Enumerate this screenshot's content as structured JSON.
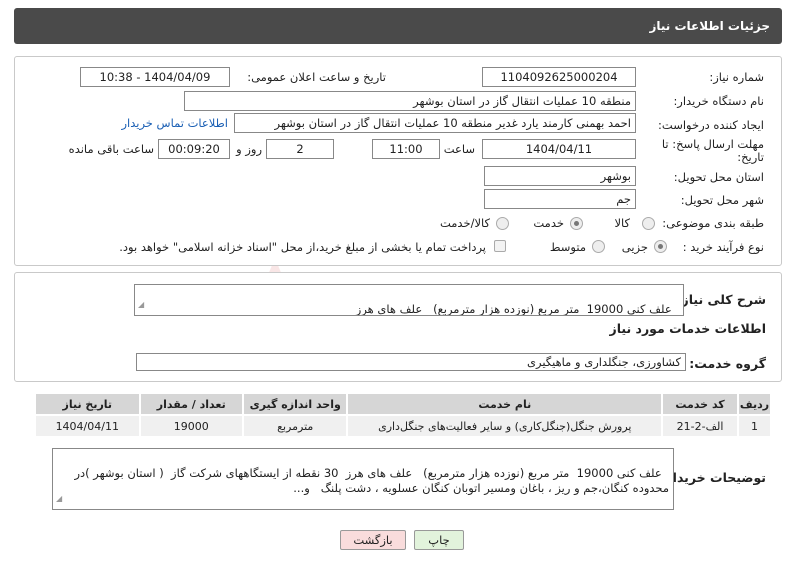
{
  "header": {
    "title": "جزئیات اطلاعات نیاز"
  },
  "form": {
    "need_number_label": "شماره نیاز:",
    "need_number": "1104092625000204",
    "announce_label": "تاریخ و ساعت اعلان عمومی:",
    "announce_value": "1404/04/09 - 10:38",
    "buyer_org_label": "نام دستگاه خریدار:",
    "buyer_org": "منطقه 10 عملیات انتقال گاز در استان بوشهر",
    "creator_label": "ایجاد کننده درخواست:",
    "creator": "احمد بهمنی کارمند یارد غدیر منطقه 10 عملیات انتقال گاز در استان بوشهر",
    "contact_link": "اطلاعات تماس خریدار",
    "deadline_label": "مهلت ارسال پاسخ: تا تاریخ:",
    "deadline_date": "1404/04/11",
    "time_label": "ساعت",
    "deadline_time": "11:00",
    "days_value": "2",
    "days_label": "روز و",
    "remaining_time": "00:09:20",
    "remaining_label": "ساعت باقی مانده",
    "province_label": "استان محل تحویل:",
    "province": "بوشهر",
    "city_label": "شهر محل تحویل:",
    "city": "جم",
    "category_label": "طبقه بندی موضوعی:",
    "category_options": [
      "کالا",
      "خدمت",
      "کالا/خدمت"
    ],
    "category_selected": "خدمت",
    "process_label": "نوع فرآیند خرید :",
    "process_options": [
      "جزیی",
      "متوسط"
    ],
    "process_selected": "جزیی",
    "payment_note": "پرداخت تمام یا بخشی از مبلغ خرید،از محل \"اسناد خزانه اسلامی\" خواهد بود."
  },
  "summary": {
    "label": "شرح کلی نیاز:",
    "text": "علف کنی 19000  متر مربع (نوزده هزار مترمربع)   علف های هرز"
  },
  "services": {
    "section_title": "اطلاعات خدمات مورد نیاز",
    "group_label": "گروه خدمت:",
    "group_value": "کشاورزی، جنگلداری و ماهیگیری",
    "columns": [
      "ردیف",
      "کد خدمت",
      "نام خدمت",
      "واحد اندازه گیری",
      "تعداد / مقدار",
      "تاریخ نیاز"
    ],
    "rows": [
      [
        "1",
        "الف-2-21",
        "پرورش جنگل(جنگل‌کاری) و سایر فعالیت‌های جنگل‌داری",
        "مترمربع",
        "19000",
        "1404/04/11"
      ]
    ]
  },
  "buyer_notes": {
    "label": "توضیحات خریدار:",
    "text": "علف کنی 19000  متر مربع (نوزده هزار مترمربع)   علف های هرز  30 نقطه از ایستگاههای شرکت گاز  ( استان بوشهر )در محدوده کنگان،جم و ریز ، باغان ومسیر اتوبان کنگان عسلویه ، دشت پلنگ   و..."
  },
  "buttons": {
    "print": "چاپ",
    "back": "بازگشت"
  },
  "watermark": "AriaTender.neT",
  "colors": {
    "header_bg": "#4a4a4a",
    "back_btn_bg": "#f9dcdc",
    "print_btn_bg": "#e2f3dc",
    "link": "#1a5fb4",
    "watermark": "#d23b3b"
  }
}
